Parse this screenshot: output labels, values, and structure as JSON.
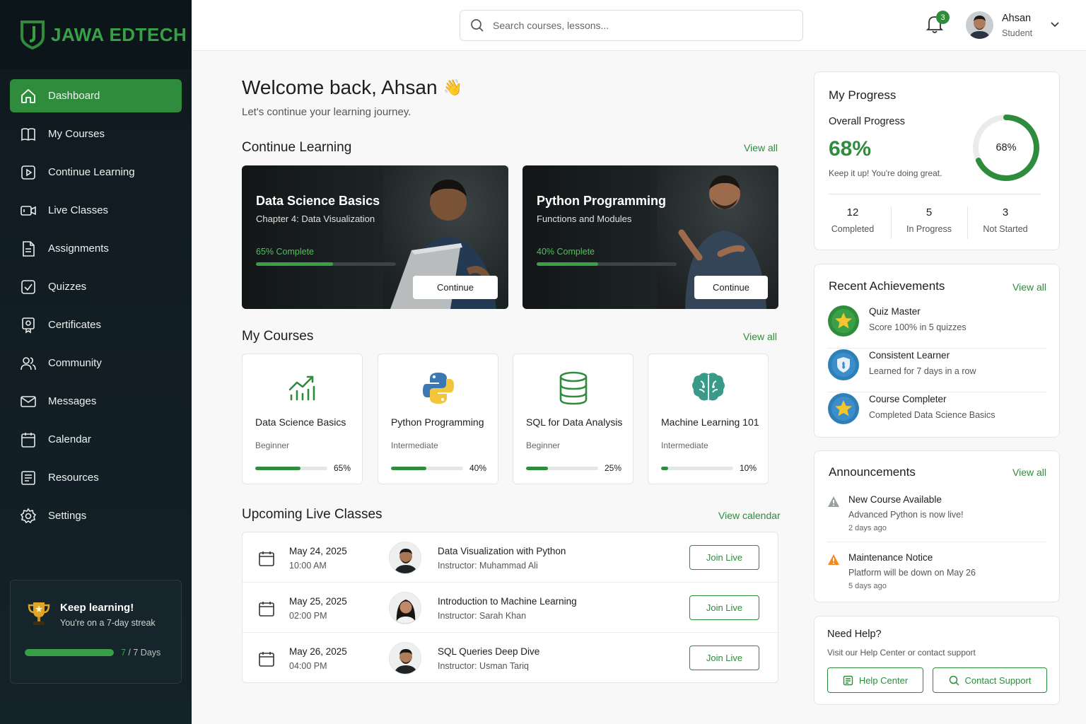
{
  "brand": {
    "name": "JAWA EDTECH",
    "accent": "#2f8c3d"
  },
  "sidebar": {
    "items": [
      {
        "label": "Dashboard",
        "icon": "home-icon",
        "active": true
      },
      {
        "label": "My Courses",
        "icon": "book-icon"
      },
      {
        "label": "Continue Learning",
        "icon": "play-icon"
      },
      {
        "label": "Live Classes",
        "icon": "video-icon"
      },
      {
        "label": "Assignments",
        "icon": "document-icon"
      },
      {
        "label": "Quizzes",
        "icon": "checkbox-icon"
      },
      {
        "label": "Certificates",
        "icon": "certificate-icon"
      },
      {
        "label": "Community",
        "icon": "users-icon"
      },
      {
        "label": "Messages",
        "icon": "mail-icon"
      },
      {
        "label": "Calendar",
        "icon": "calendar-icon"
      },
      {
        "label": "Resources",
        "icon": "list-icon"
      },
      {
        "label": "Settings",
        "icon": "gear-icon"
      }
    ],
    "streak": {
      "title": "Keep learning!",
      "subtitle": "You're on a 7-day streak",
      "current": "7",
      "total": " / 7 Days",
      "progress": 1.0
    }
  },
  "topbar": {
    "search_placeholder": "Search courses, lessons...",
    "notifications": "3",
    "user_name": "Ahsan",
    "user_role": "Student"
  },
  "welcome": {
    "title": "Welcome back, Ahsan",
    "emoji": "👋",
    "subtitle": "Let's continue your learning journey."
  },
  "continue_learning": {
    "title": "Continue Learning",
    "view_all": "View all",
    "cards": [
      {
        "title": "Data Science Basics",
        "subtitle": "Chapter 4: Data Visualization",
        "progress_label": "65% Complete",
        "progress": 0.55,
        "button": "Continue"
      },
      {
        "title": "Python Programming",
        "subtitle": "Functions and Modules",
        "progress_label": "40% Complete",
        "progress": 0.44,
        "button": "Continue"
      }
    ]
  },
  "my_courses": {
    "title": "My Courses",
    "view_all": "View all",
    "items": [
      {
        "name": "Data Science Basics",
        "level": "Beginner",
        "pct": "65%",
        "progress": 0.63,
        "icon": "chart-up-icon"
      },
      {
        "name": "Python Programming",
        "level": "Intermediate",
        "pct": "40%",
        "progress": 0.49,
        "icon": "python-logo-icon"
      },
      {
        "name": "SQL for Data Analysis",
        "level": "Beginner",
        "pct": "25%",
        "progress": 0.3,
        "icon": "database-icon"
      },
      {
        "name": "Machine Learning 101",
        "level": "Intermediate",
        "pct": "10%",
        "progress": 0.1,
        "icon": "brain-icon"
      }
    ]
  },
  "live_classes": {
    "title": "Upcoming Live Classes",
    "view_calendar": "View calendar",
    "items": [
      {
        "date": "May 24, 2025",
        "time": "10:00 AM",
        "title": "Data Visualization with Python",
        "instructor": "Instructor: Muhammad Ali",
        "button": "Join Live"
      },
      {
        "date": "May 25, 2025",
        "time": "02:00 PM",
        "title": "Introduction to Machine Learning",
        "instructor": "Instructor: Sarah Khan",
        "button": "Join Live"
      },
      {
        "date": "May 26, 2025",
        "time": "04:00 PM",
        "title": "SQL Queries Deep Dive",
        "instructor": "Instructor: Usman Tariq",
        "button": "Join Live"
      }
    ]
  },
  "progress": {
    "title": "My Progress",
    "overall_label": "Overall Progress",
    "overall_value": "68%",
    "overall_fraction": 0.68,
    "note": "Keep it up! You're doing great.",
    "stats": [
      {
        "num": "12",
        "label": "Completed"
      },
      {
        "num": "5",
        "label": "In Progress"
      },
      {
        "num": "3",
        "label": "Not Started"
      }
    ]
  },
  "achievements": {
    "title": "Recent Achievements",
    "view_all": "View all",
    "items": [
      {
        "title": "Quiz Master",
        "subtitle": "Score 100% in 5 quizzes",
        "icon": "star-badge-icon",
        "color": "#2f8c3d"
      },
      {
        "title": "Consistent Learner",
        "subtitle": "Learned for 7 days in a row",
        "icon": "shield-badge-icon",
        "color": "#2d7fb8"
      },
      {
        "title": "Course Completer",
        "subtitle": "Completed Data Science Basics",
        "icon": "star-badge-icon",
        "color": "#2d7fb8"
      }
    ]
  },
  "announcements": {
    "title": "Announcements",
    "view_all": "View all",
    "items": [
      {
        "title": "New Course Available",
        "subtitle": "Advanced Python is now live!",
        "time": "2 days ago",
        "icon": "warning-icon",
        "color": "#9aa09c"
      },
      {
        "title": "Maintenance Notice",
        "subtitle": "Platform will be down on May 26",
        "time": "5 days ago",
        "icon": "warning-icon",
        "color": "#f08a24"
      }
    ]
  },
  "help": {
    "title": "Need Help?",
    "subtitle": "Visit our Help Center or contact support",
    "help_center": "Help Center",
    "contact_support": "Contact Support"
  }
}
